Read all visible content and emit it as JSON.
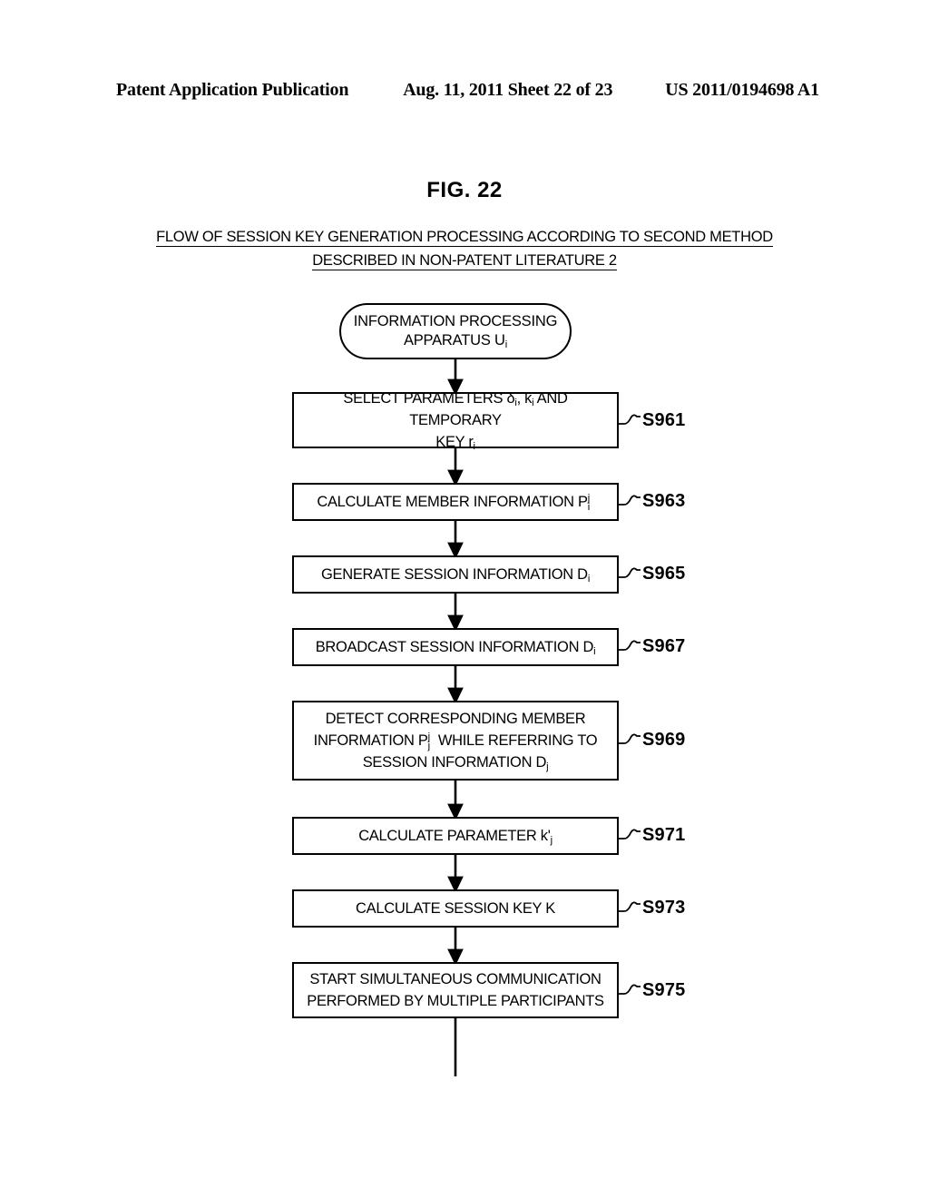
{
  "header": {
    "left": "Patent Application Publication",
    "middle": "Aug. 11, 2011  Sheet 22 of 23",
    "right": "US 2011/0194698 A1"
  },
  "figure": {
    "label": "FIG. 22",
    "caption_line1": "FLOW OF SESSION KEY GENERATION PROCESSING ACCORDING TO SECOND METHOD",
    "caption_line2": "DESCRIBED IN NON-PATENT LITERATURE 2"
  },
  "flowchart": {
    "start_node": {
      "text_line1": "INFORMATION PROCESSING",
      "text_line2_prefix": "APPARATUS U",
      "text_line2_sub": "i"
    },
    "steps": [
      {
        "ref": "S961",
        "lines": [
          {
            "parts": [
              {
                "t": "text",
                "v": "SELECT PARAMETERS δ"
              },
              {
                "t": "sub",
                "v": "i"
              },
              {
                "t": "text",
                "v": ", k"
              },
              {
                "t": "sub",
                "v": "i"
              },
              {
                "t": "text",
                "v": " AND TEMPORARY"
              }
            ]
          },
          {
            "parts": [
              {
                "t": "text",
                "v": "KEY r"
              },
              {
                "t": "sub",
                "v": "i"
              }
            ]
          }
        ]
      },
      {
        "ref": "S963",
        "lines": [
          {
            "parts": [
              {
                "t": "text",
                "v": "CALCULATE MEMBER INFORMATION P"
              },
              {
                "t": "subsup",
                "sub": "i",
                "sup": "j"
              }
            ]
          }
        ]
      },
      {
        "ref": "S965",
        "lines": [
          {
            "parts": [
              {
                "t": "text",
                "v": "GENERATE SESSION INFORMATION D"
              },
              {
                "t": "sub",
                "v": "i"
              }
            ]
          }
        ]
      },
      {
        "ref": "S967",
        "lines": [
          {
            "parts": [
              {
                "t": "text",
                "v": "BROADCAST SESSION INFORMATION D"
              },
              {
                "t": "sub",
                "v": "i"
              }
            ]
          }
        ]
      },
      {
        "ref": "S969",
        "lines": [
          {
            "parts": [
              {
                "t": "text",
                "v": "DETECT CORRESPONDING MEMBER"
              }
            ]
          },
          {
            "parts": [
              {
                "t": "text",
                "v": "INFORMATION P"
              },
              {
                "t": "subsup",
                "sub": "j",
                "sup": "j"
              },
              {
                "t": "text",
                "v": " WHILE REFERRING TO"
              }
            ]
          },
          {
            "parts": [
              {
                "t": "text",
                "v": "SESSION INFORMATION D"
              },
              {
                "t": "sub",
                "v": "j"
              }
            ]
          }
        ]
      },
      {
        "ref": "S971",
        "lines": [
          {
            "parts": [
              {
                "t": "text",
                "v": "CALCULATE PARAMETER k'"
              },
              {
                "t": "sub",
                "v": "j"
              }
            ]
          }
        ]
      },
      {
        "ref": "S973",
        "lines": [
          {
            "parts": [
              {
                "t": "text",
                "v": "CALCULATE SESSION KEY K"
              }
            ]
          }
        ]
      },
      {
        "ref": "S975",
        "lines": [
          {
            "parts": [
              {
                "t": "text",
                "v": "START SIMULTANEOUS COMMUNICATION"
              }
            ]
          },
          {
            "parts": [
              {
                "t": "text",
                "v": "PERFORMED BY MULTIPLE PARTICIPANTS"
              }
            ]
          }
        ]
      }
    ]
  },
  "colors": {
    "ink": "#000000",
    "paper": "#ffffff"
  }
}
